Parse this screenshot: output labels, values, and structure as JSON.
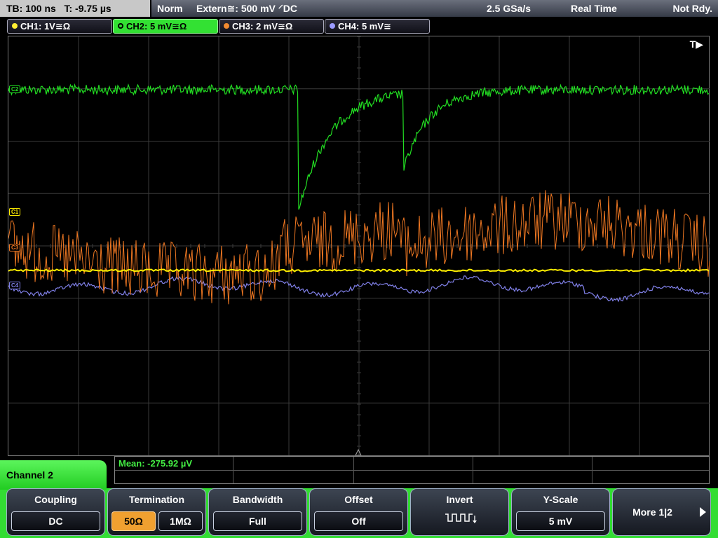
{
  "status_bar": {
    "timebase": "TB: 100 ns",
    "trigger_time": "T: -9.75 µs",
    "mode": "Norm",
    "trigger": "Extern≅: 500 mV ⸍DC",
    "sample_rate": "2.5 GSa/s",
    "acquire_mode": "Real Time",
    "state": "Not Rdy."
  },
  "channel_tabs": [
    {
      "label": "CH1: 1V≅Ω",
      "color": "#ffee33"
    },
    {
      "label": "CH2: 5 mV≅Ω",
      "color": "#33e133"
    },
    {
      "label": "CH3: 2 mV≅Ω",
      "color": "#f08a30"
    },
    {
      "label": "CH4: 5 mV≅",
      "color": "#9b9bff"
    }
  ],
  "screen": {
    "trigger_label": "T▶",
    "markers": {
      "c1": "C1",
      "c2": "C2",
      "c3": "C3",
      "c4": "C4"
    },
    "colors": {
      "ch1": "#ffee00",
      "ch2": "#22dd22",
      "ch3": "#ee7722",
      "ch4": "#8080e8",
      "grid": "#3a3a3a"
    }
  },
  "measurement": {
    "mean": "Mean: -275.92 µV"
  },
  "menu": {
    "title": "Channel 2",
    "softkeys": {
      "coupling": {
        "title": "Coupling",
        "value": "DC"
      },
      "termination": {
        "title": "Termination",
        "options": [
          "50Ω",
          "1MΩ"
        ],
        "selected": 0
      },
      "bandwidth": {
        "title": "Bandwidth",
        "value": "Full"
      },
      "offset": {
        "title": "Offset",
        "value": "Off"
      },
      "invert": {
        "title": "Invert",
        "icon": "invert-waveform-icon"
      },
      "y_scale": {
        "title": "Y-Scale",
        "value": "5 mV"
      },
      "more": {
        "label": "More 1|2"
      }
    }
  }
}
